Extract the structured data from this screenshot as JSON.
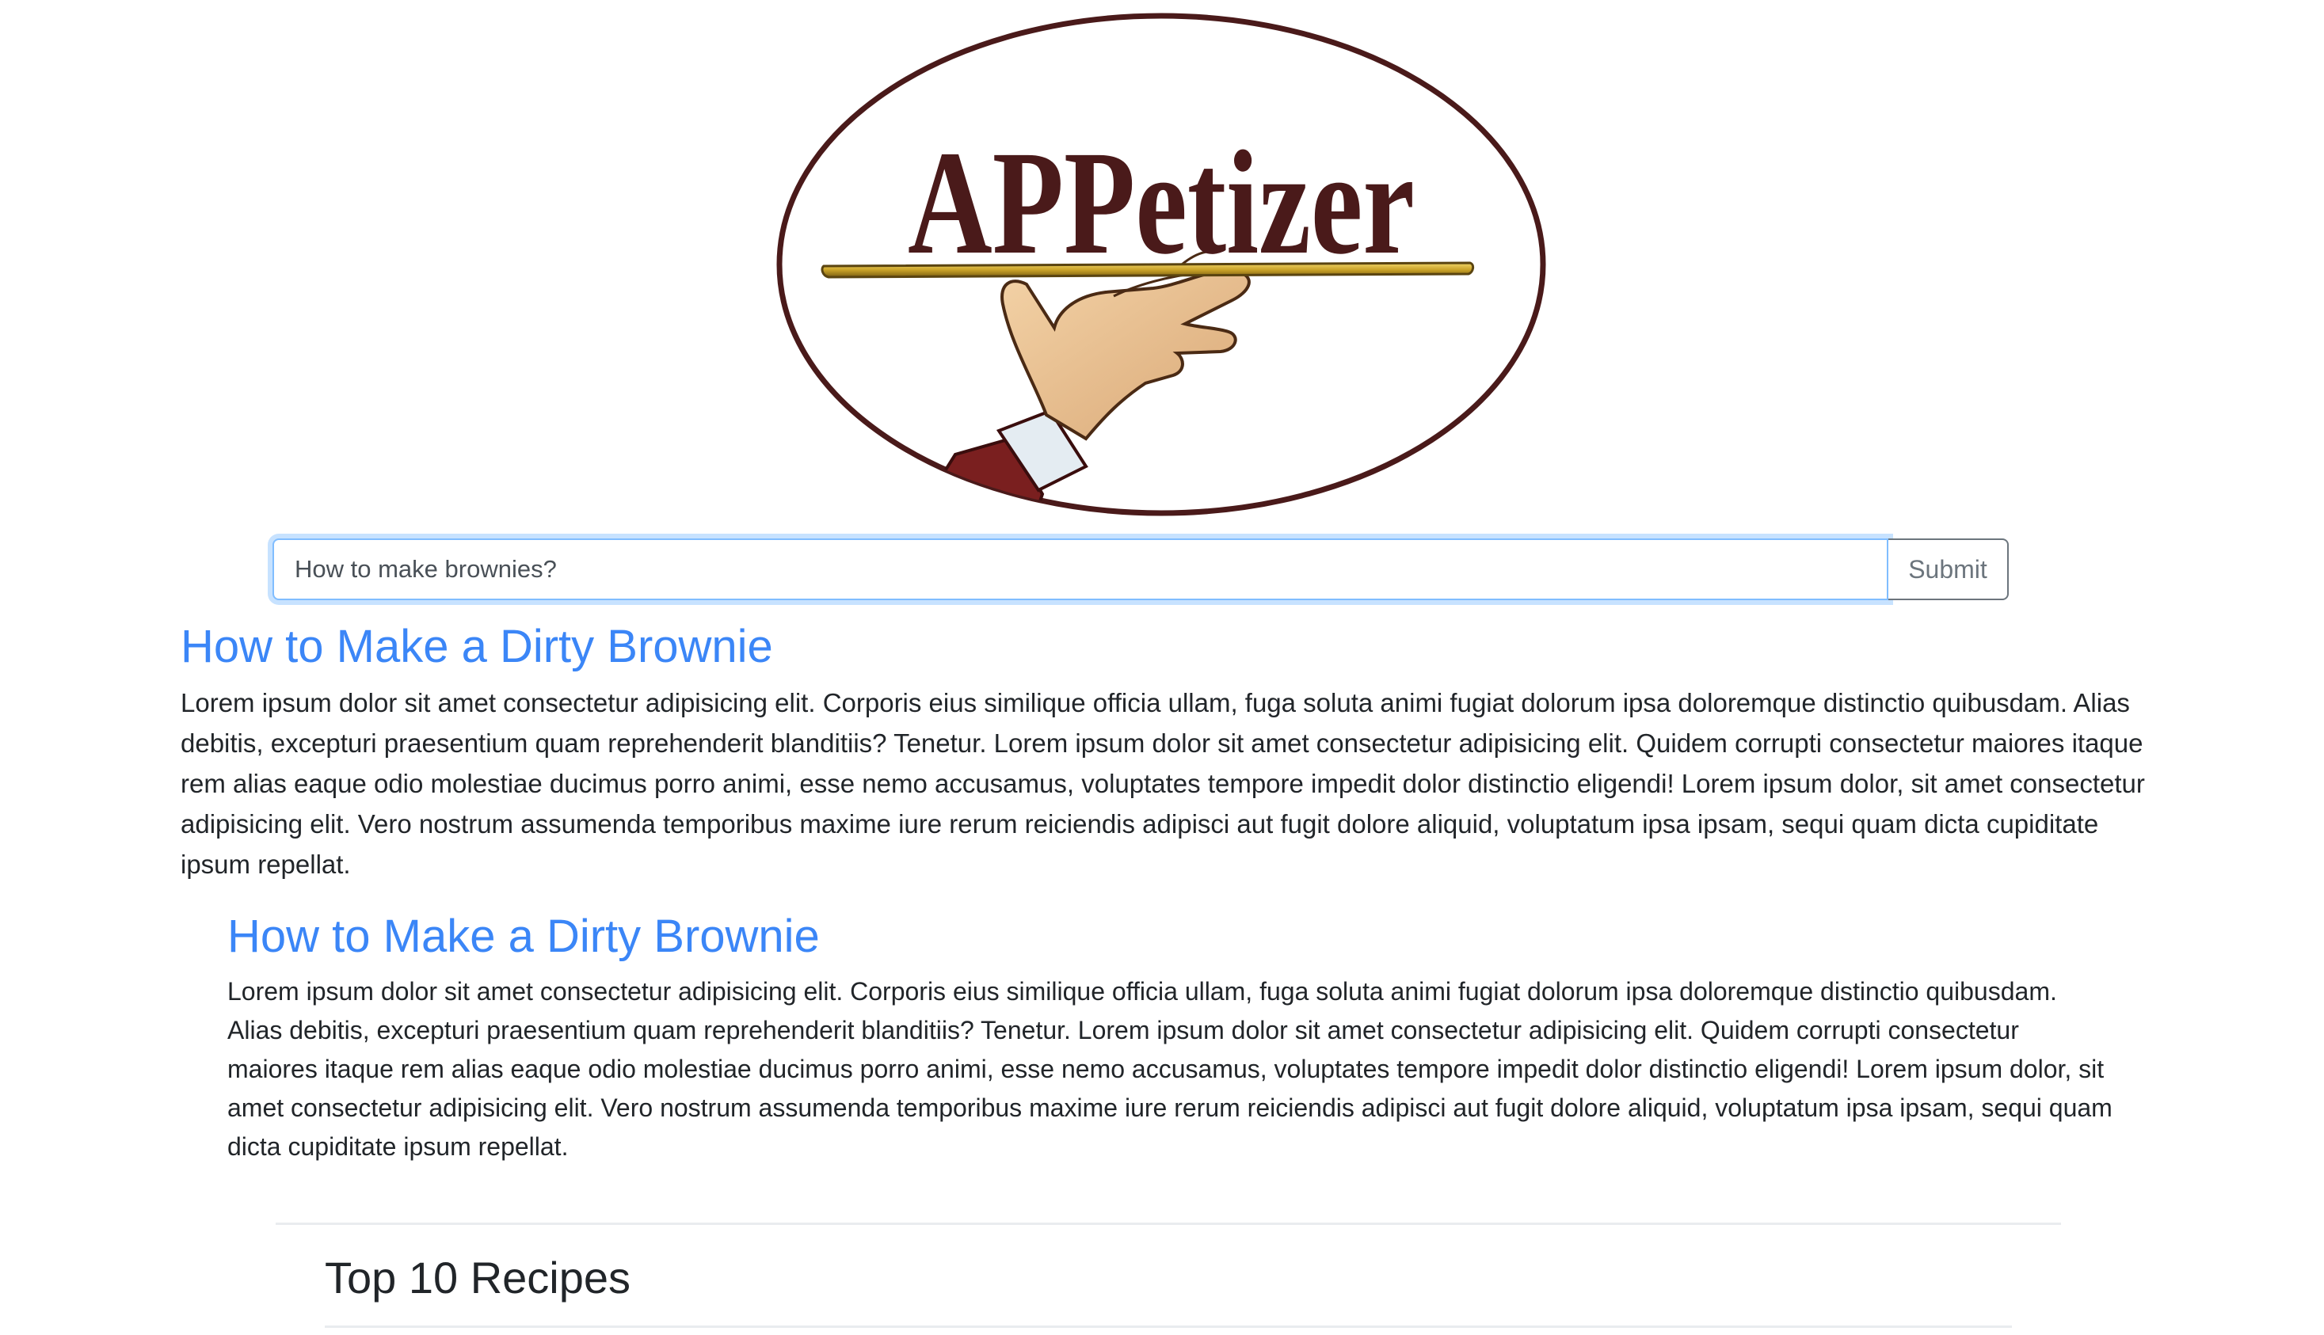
{
  "logo": {
    "text": "APPetizer",
    "border_color": "#4a1a1a",
    "text_color": "#4a1a1a",
    "tray_color": "#c9a227"
  },
  "search": {
    "value": "How to make brownies?",
    "submit_label": "Submit",
    "focus_color": "#80bdff"
  },
  "results": [
    {
      "title": "How to Make a Dirty Brownie",
      "body": "Lorem ipsum dolor sit amet consectetur adipisicing elit. Corporis eius similique officia ullam, fuga soluta animi fugiat dolorum ipsa doloremque distinctio quibusdam. Alias debitis, excepturi praesentium quam reprehenderit blanditiis? Tenetur. Lorem ipsum dolor sit amet consectetur adipisicing elit. Quidem corrupti consectetur maiores itaque rem alias eaque odio molestiae ducimus porro animi, esse nemo accusamus, voluptates tempore impedit dolor distinctio eligendi! Lorem ipsum dolor, sit amet consectetur adipisicing elit. Vero nostrum assumenda temporibus maxime iure rerum reiciendis adipisci aut fugit dolore aliquid, voluptatum ipsa ipsam, sequi quam dicta cupiditate ipsum repellat."
    },
    {
      "title": "How to Make a Dirty Brownie",
      "body": "Lorem ipsum dolor sit amet consectetur adipisicing elit. Corporis eius similique officia ullam, fuga soluta animi fugiat dolorum ipsa doloremque distinctio quibusdam. Alias debitis, excepturi praesentium quam reprehenderit blanditiis? Tenetur. Lorem ipsum dolor sit amet consectetur adipisicing elit. Quidem corrupti consectetur maiores itaque rem alias eaque odio molestiae ducimus porro animi, esse nemo accusamus, voluptates tempore impedit dolor distinctio eligendi! Lorem ipsum dolor, sit amet consectetur adipisicing elit. Vero nostrum assumenda temporibus maxime iure rerum reiciendis adipisci aut fugit dolore aliquid, voluptatum ipsa ipsam, sequi quam dicta cupiditate ipsum repellat."
    }
  ],
  "top_recipes": {
    "heading": "Top 10 Recipes"
  },
  "colors": {
    "link": "#3b86f7",
    "text": "#212529",
    "divider": "#e9ecef"
  }
}
